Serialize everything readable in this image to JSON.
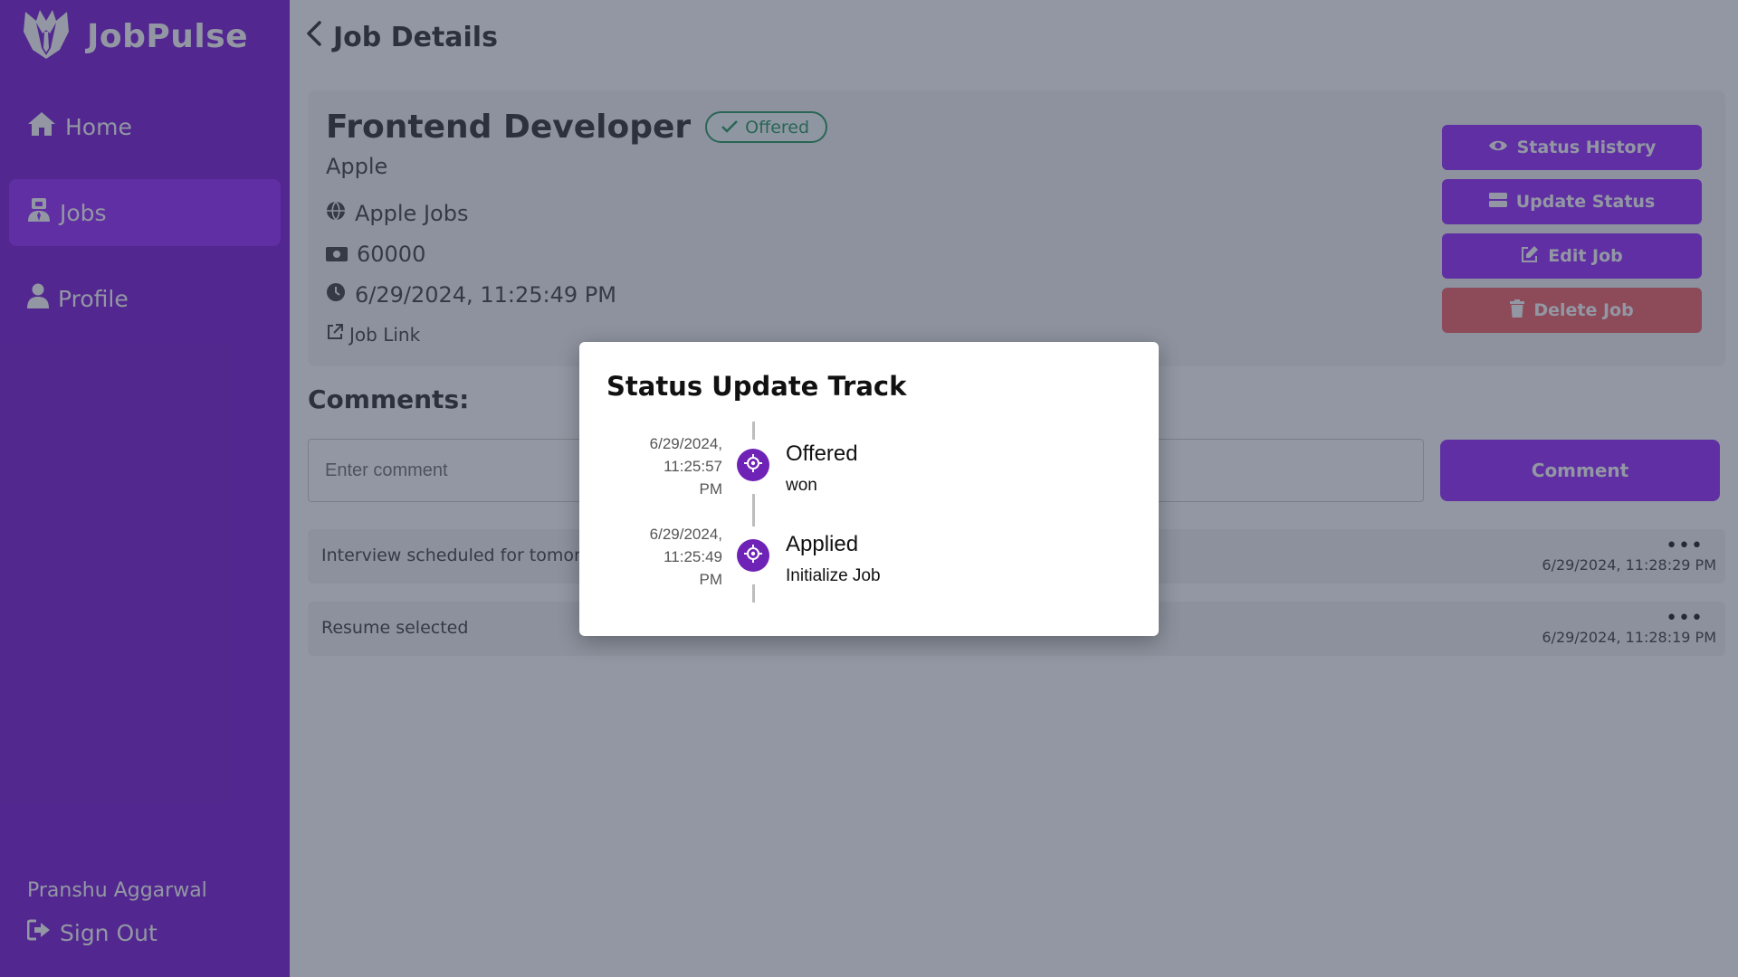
{
  "app": {
    "name": "JobPulse"
  },
  "sidebar": {
    "items": [
      {
        "label": "Home",
        "icon": "home-icon"
      },
      {
        "label": "Jobs",
        "icon": "jobs-icon",
        "active": true
      },
      {
        "label": "Profile",
        "icon": "user-icon"
      }
    ],
    "user_name": "Pranshu Aggarwal",
    "sign_out_label": "Sign Out"
  },
  "header": {
    "title": "Job Details",
    "back_icon": "chevron-left-icon"
  },
  "job": {
    "title": "Frontend Developer",
    "status": "Offered",
    "company": "Apple",
    "source": "Apple Jobs",
    "salary": "60000",
    "date": "6/29/2024, 11:25:49 PM",
    "link_label": "Job Link"
  },
  "actions": {
    "status_history": "Status History",
    "update_status": "Update Status",
    "edit_job": "Edit Job",
    "delete_job": "Delete Job"
  },
  "comments": {
    "title": "Comments:",
    "input_placeholder": "Enter comment",
    "button_label": "Comment",
    "items": [
      {
        "text": "Interview scheduled for tomorrow",
        "time": "6/29/2024, 11:28:29 PM"
      },
      {
        "text": "Resume selected",
        "time": "6/29/2024, 11:28:19 PM"
      }
    ]
  },
  "modal": {
    "title": "Status Update Track",
    "events": [
      {
        "date": "6/29/2024,",
        "time": "11:25:57",
        "ampm": "PM",
        "status": "Offered",
        "note": "won"
      },
      {
        "date": "6/29/2024,",
        "time": "11:25:49",
        "ampm": "PM",
        "status": "Applied",
        "note": "Initialize Job"
      }
    ]
  },
  "colors": {
    "sidebar": "#7e1fd6",
    "sidebar_active": "#9b2ffe",
    "primary_button": "#9b2ffe",
    "danger_button": "#f4666a",
    "success_badge": "#2e9a63",
    "timeline_dot": "#6f22b6"
  }
}
